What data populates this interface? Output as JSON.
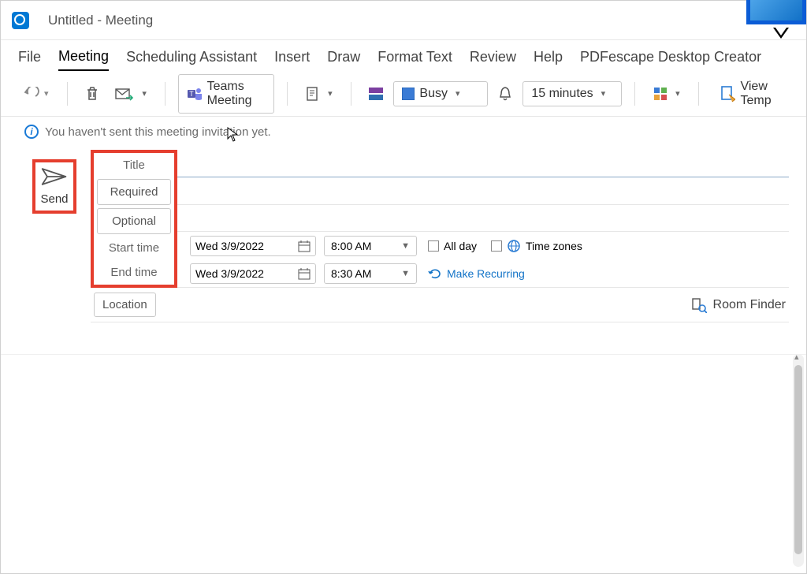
{
  "title": "Untitled  -  Meeting",
  "menu": {
    "file": "File",
    "meeting": "Meeting",
    "scheduling": "Scheduling Assistant",
    "insert": "Insert",
    "draw": "Draw",
    "format": "Format Text",
    "review": "Review",
    "help": "Help",
    "pdfescape": "PDFescape Desktop Creator"
  },
  "ribbon": {
    "teams": "Teams Meeting",
    "busy": "Busy",
    "reminder": "15 minutes",
    "viewtemp": "View Temp"
  },
  "info": "You haven't sent this meeting invitation yet.",
  "send": "Send",
  "labels": {
    "title": "Title",
    "required": "Required",
    "optional": "Optional",
    "start": "Start time",
    "end": "End time",
    "location": "Location"
  },
  "fields": {
    "start_date": "Wed 3/9/2022",
    "start_time": "8:00 AM",
    "end_date": "Wed 3/9/2022",
    "end_time": "8:30 AM",
    "allday": "All day",
    "timezones": "Time zones",
    "recurring": "Make Recurring",
    "roomfinder": "Room Finder"
  }
}
